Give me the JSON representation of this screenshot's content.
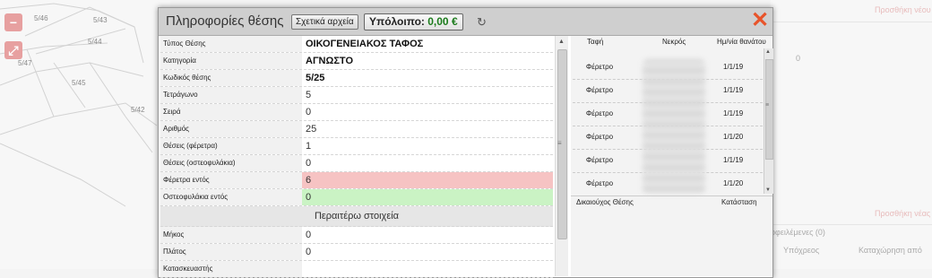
{
  "map": {
    "plots": [
      "5/46",
      "5/43",
      "5/44",
      "5/47",
      "5/45",
      "5/42"
    ],
    "zoom_icon": "minus-icon",
    "expand_icon": "expand-icon"
  },
  "background_right": {
    "top_ghost": "Προσθήκη νέου",
    "zero": "0",
    "mid_ghost": "Προσθήκη νέας",
    "sub_ghost": "οφειλέμενες (0)",
    "col1": "Υπόχρεος",
    "col2": "Καταχώρηση από"
  },
  "modal": {
    "title": "Πληροφορίες θέσης",
    "files_button": "Σχετικά αρχεία",
    "balance_label": "Υπόλοιπο:",
    "balance_value": "0,00 €",
    "refresh_icon": "refresh-icon",
    "close_icon": "close-icon",
    "close_color": "#e8542a"
  },
  "properties": [
    {
      "label": "Τύπος Θέσης",
      "value": "ΟΙΚΟΓΕΝΕΙΑΚΟΣ ΤΑΦΟΣ",
      "style": "bold"
    },
    {
      "label": "Κατηγορία",
      "value": "ΑΓΝΩΣΤΟ",
      "style": "bold"
    },
    {
      "label": "Κωδικός θέσης",
      "value": "5/25",
      "style": "bold"
    },
    {
      "label": "Τετράγωνο",
      "value": "5",
      "style": ""
    },
    {
      "label": "Σειρά",
      "value": "0",
      "style": ""
    },
    {
      "label": "Αριθμός",
      "value": "25",
      "style": ""
    },
    {
      "label": "Θέσεις (φέρετρα)",
      "value": "1",
      "style": ""
    },
    {
      "label": "Θέσεις (οστεοφυλάκια)",
      "value": "0",
      "style": ""
    },
    {
      "label": "Φέρετρα εντός",
      "value": "6",
      "style": "red"
    },
    {
      "label": "Οστεοφυλάκια εντός",
      "value": "0",
      "style": "green"
    }
  ],
  "section_title": "Περαιτέρω στοιχεία",
  "extra_properties": [
    {
      "label": "Μήκος",
      "value": "0"
    },
    {
      "label": "Πλάτος",
      "value": "0"
    },
    {
      "label": "Κατασκευαστής",
      "value": ""
    }
  ],
  "burials": {
    "headers": {
      "burial": "Ταφή",
      "deceased": "Νεκρός",
      "death_date": "Ημ/νία θανάτου"
    },
    "rows": [
      {
        "type": "Φέρετρο",
        "date": "1/1/19"
      },
      {
        "type": "Φέρετρο",
        "date": "1/1/19"
      },
      {
        "type": "Φέρετρο",
        "date": "1/1/19"
      },
      {
        "type": "Φέρετρο",
        "date": "1/1/20"
      },
      {
        "type": "Φέρετρο",
        "date": "1/1/19"
      },
      {
        "type": "Φέρετρο",
        "date": "1/1/20"
      }
    ],
    "footer_holder": "Δικαιούχος Θέσης",
    "footer_status": "Κατάσταση"
  }
}
